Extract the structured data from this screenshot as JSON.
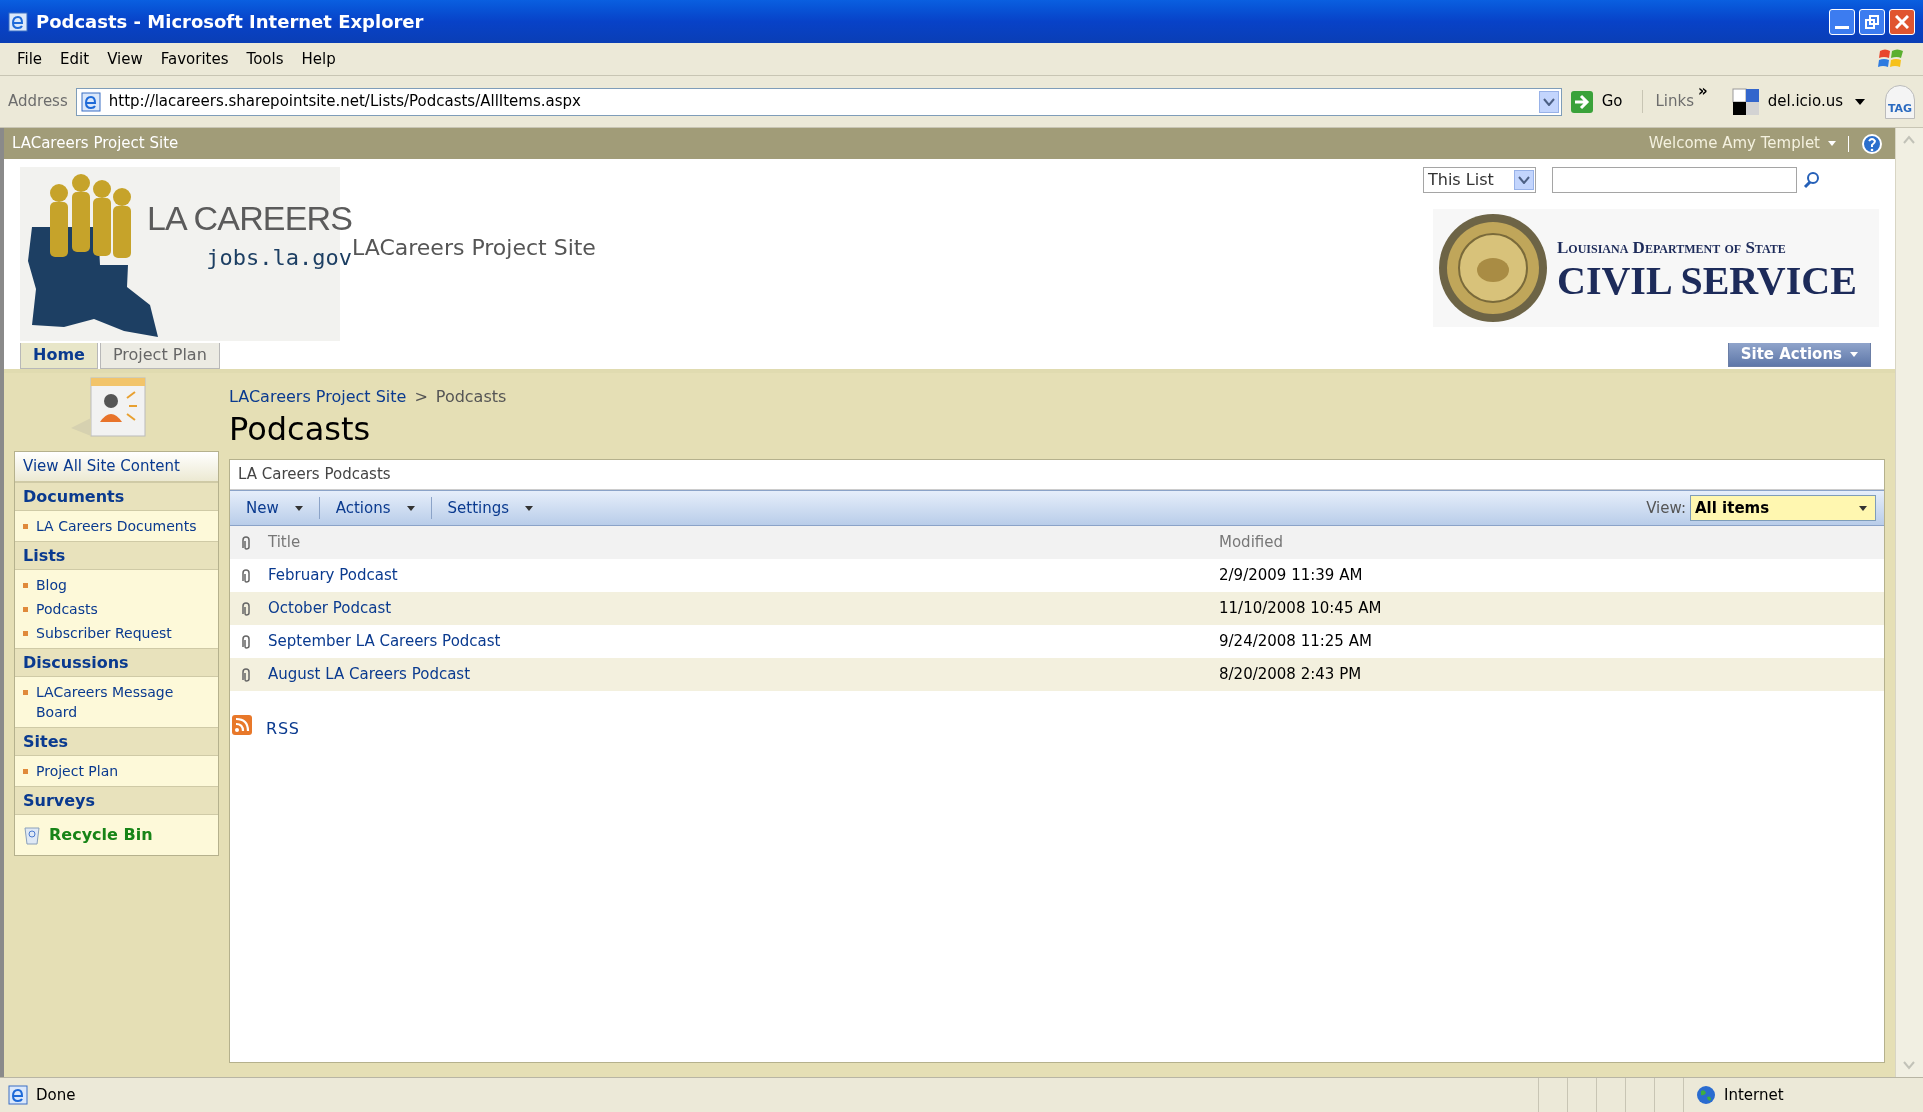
{
  "window": {
    "title": "Podcasts - Microsoft Internet Explorer"
  },
  "menu": [
    "File",
    "Edit",
    "View",
    "Favorites",
    "Tools",
    "Help"
  ],
  "address_bar": {
    "label": "Address",
    "url": "http://lacareers.sharepointsite.net/Lists/Podcasts/AllItems.aspx",
    "go": "Go",
    "links": "Links",
    "chevron": "»",
    "bookmark": "del.icio.us",
    "tag": "TAG"
  },
  "site_bar": {
    "site": "LACareers Project Site",
    "welcome": "Welcome Amy Templet"
  },
  "search": {
    "scope": "This List"
  },
  "header": {
    "logo_title": "LA CAREERS",
    "logo_url": "jobs.la.gov",
    "site_title": "LACareers Project Site",
    "agency_line": "Louisiana Department of State",
    "agency_name": "CIVIL SERVICE"
  },
  "tabs": [
    {
      "label": "Home",
      "selected": true
    },
    {
      "label": "Project Plan",
      "selected": false
    }
  ],
  "site_actions": "Site Actions",
  "breadcrumb": {
    "parent": "LACareers Project Site",
    "separator": ">",
    "current": "Podcasts"
  },
  "page_title": "Podcasts",
  "sidebar": {
    "view_all": "View All Site Content",
    "sections": [
      {
        "heading": "Documents",
        "items": [
          "LA Careers Documents"
        ]
      },
      {
        "heading": "Lists",
        "items": [
          "Blog",
          "Podcasts",
          "Subscriber Request"
        ]
      },
      {
        "heading": "Discussions",
        "items": [
          "LACareers Message Board"
        ]
      },
      {
        "heading": "Sites",
        "items": [
          "Project Plan"
        ]
      },
      {
        "heading": "Surveys"
      }
    ],
    "recycle_bin": "Recycle Bin"
  },
  "list": {
    "description": "LA Careers Podcasts",
    "toolbar": [
      "New",
      "Actions",
      "Settings"
    ],
    "view_label": "View:",
    "view_value": "All items",
    "columns": [
      "Title",
      "Modified"
    ],
    "rows": [
      {
        "title": "February Podcast",
        "modified": "2/9/2009 11:39 AM"
      },
      {
        "title": "October Podcast",
        "modified": "11/10/2008 10:45 AM"
      },
      {
        "title": "September LA Careers Podcast",
        "modified": "9/24/2008 11:25 AM"
      },
      {
        "title": "August LA Careers Podcast",
        "modified": "8/20/2008 2:43 PM"
      }
    ],
    "rss": "RSS"
  },
  "status_bar": {
    "text": "Done",
    "zone": "Internet"
  }
}
